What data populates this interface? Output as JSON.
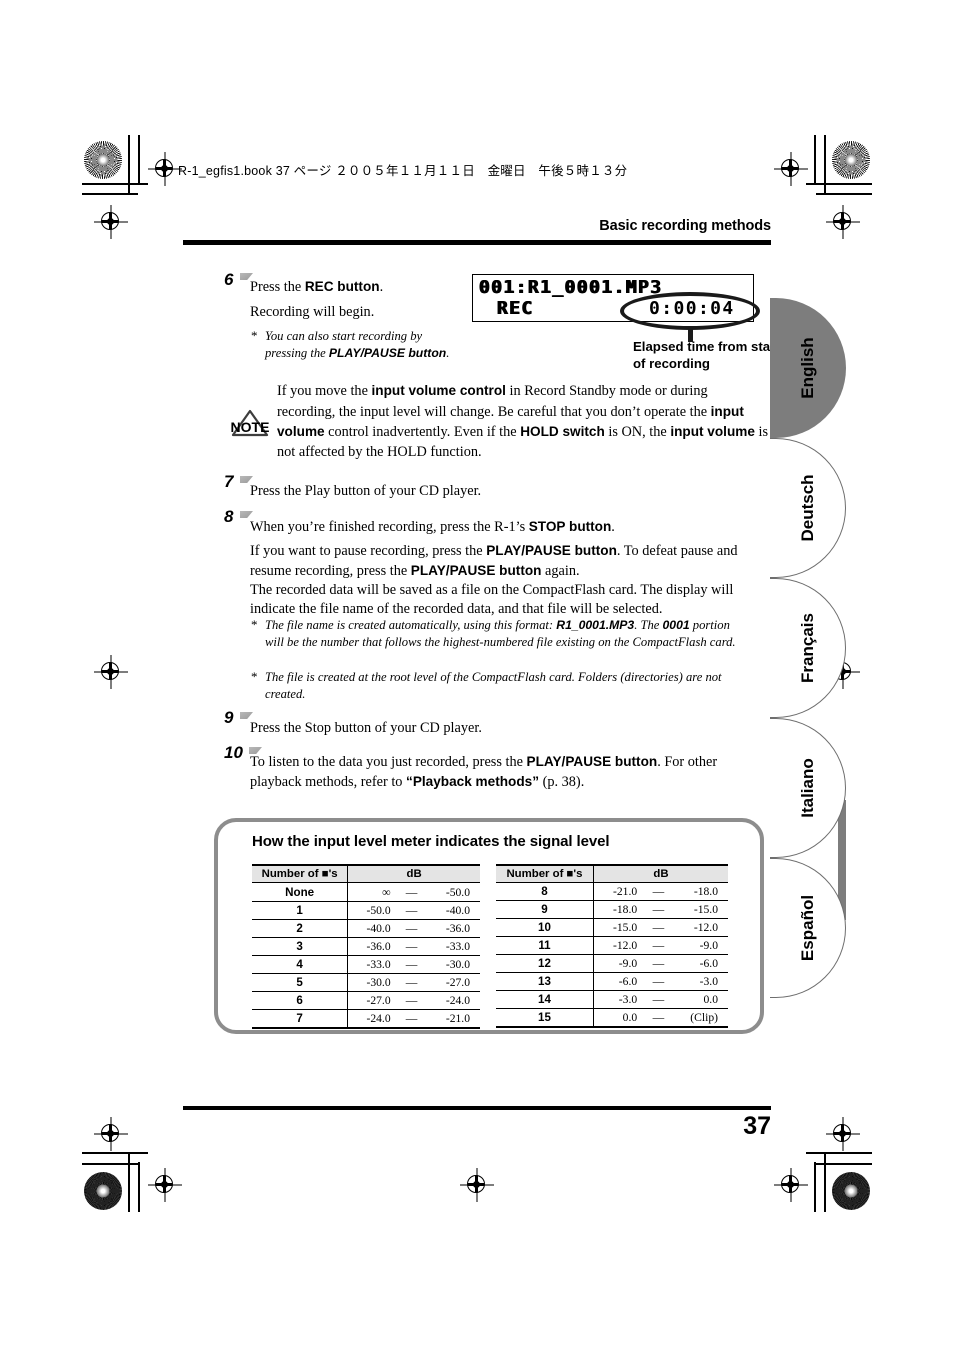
{
  "header": {
    "file_stamp": "R-1_egfis1.book  37 ページ  ２００５年１１月１１日　金曜日　午後５時１３分",
    "section_title": "Basic recording methods",
    "page_number": "37"
  },
  "steps": [
    {
      "number": "6",
      "lines": [
        "Press the <b>REC button</b>.",
        "Recording will begin."
      ],
      "footnotes": [
        "You can also start recording by pressing the <b>PLAY/PAUSE button</b>."
      ]
    },
    {
      "number": "7",
      "lines": [
        "Press the Play button of your CD player."
      ],
      "footnotes": []
    },
    {
      "number": "8",
      "lines": [
        "When you’re finished recording, press the R-1’s <b>STOP button</b>.",
        "If you want to pause recording, press the <b>PLAY/PAUSE button</b>. To defeat pause and resume recording, press the <b>PLAY/PAUSE button</b> again.<br>The recorded data will be saved as a file on the CompactFlash card. The display will indicate the file name of the recorded data, and that file will be selected."
      ],
      "footnotes": [
        "The file name is created automatically, using this format: <b>R1_0001.MP3</b>. The <b>0001</b> portion will be the number that follows the highest-numbered file existing on the CompactFlash card.",
        "The file is created at the root level of the CompactFlash card. Folders (directories) are not created."
      ]
    },
    {
      "number": "9",
      "lines": [
        "Press the Stop button of your CD player."
      ],
      "footnotes": []
    },
    {
      "number": "10",
      "lines": [
        "To listen to the data you just recorded, press the <b>PLAY/PAUSE button</b>. For other playback methods, refer to <b>“Playback methods”</b> (p. 38)."
      ],
      "footnotes": []
    }
  ],
  "note_box": {
    "icon_label": "NOTE",
    "text": "If you move the <b>input volume control</b> in Record Standby mode or during recording, the input level will change. Be careful that you don’t operate the <b>input volume</b> control inadvertently. Even if the <b>HOLD switch</b> is ON, the <b>input volume</b> is not affected by the HOLD function."
  },
  "lcd": {
    "line1": "001:R1_0001.MP3",
    "line2": "REC",
    "time": "0:00:04",
    "callout": "Elapsed time from start of recording"
  },
  "panel": {
    "title": "How the input level meter indicates the signal level",
    "columns": [
      "Number of ■'s",
      "dB"
    ],
    "left_rows": [
      {
        "count": "None",
        "low": "∞",
        "dash": "—",
        "high": "-50.0"
      },
      {
        "count": "1",
        "low": "-50.0",
        "dash": "—",
        "high": "-40.0"
      },
      {
        "count": "2",
        "low": "-40.0",
        "dash": "—",
        "high": "-36.0"
      },
      {
        "count": "3",
        "low": "-36.0",
        "dash": "—",
        "high": "-33.0"
      },
      {
        "count": "4",
        "low": "-33.0",
        "dash": "—",
        "high": "-30.0"
      },
      {
        "count": "5",
        "low": "-30.0",
        "dash": "—",
        "high": "-27.0"
      },
      {
        "count": "6",
        "low": "-27.0",
        "dash": "—",
        "high": "-24.0"
      },
      {
        "count": "7",
        "low": "-24.0",
        "dash": "—",
        "high": "-21.0"
      }
    ],
    "right_rows": [
      {
        "count": "8",
        "low": "-21.0",
        "dash": "—",
        "high": "-18.0"
      },
      {
        "count": "9",
        "low": "-18.0",
        "dash": "—",
        "high": "-15.0"
      },
      {
        "count": "10",
        "low": "-15.0",
        "dash": "—",
        "high": "-12.0"
      },
      {
        "count": "11",
        "low": "-12.0",
        "dash": "—",
        "high": "-9.0"
      },
      {
        "count": "12",
        "low": "-9.0",
        "dash": "—",
        "high": "-6.0"
      },
      {
        "count": "13",
        "low": "-6.0",
        "dash": "—",
        "high": "-3.0"
      },
      {
        "count": "14",
        "low": "-3.0",
        "dash": "—",
        "high": "0.0"
      },
      {
        "count": "15",
        "low": "0.0",
        "dash": "—",
        "high": "(Clip)"
      }
    ]
  },
  "language_tabs": [
    {
      "label": "English",
      "active": true
    },
    {
      "label": "Deutsch",
      "active": false
    },
    {
      "label": "Français",
      "active": false
    },
    {
      "label": "Italiano",
      "active": false
    },
    {
      "label": "Español",
      "active": false
    }
  ],
  "colors": {
    "active_tab": "#7d7d7d",
    "panel_border": "#8d8d8d",
    "table_header": "#e4e4e4",
    "rule": "#000000"
  }
}
